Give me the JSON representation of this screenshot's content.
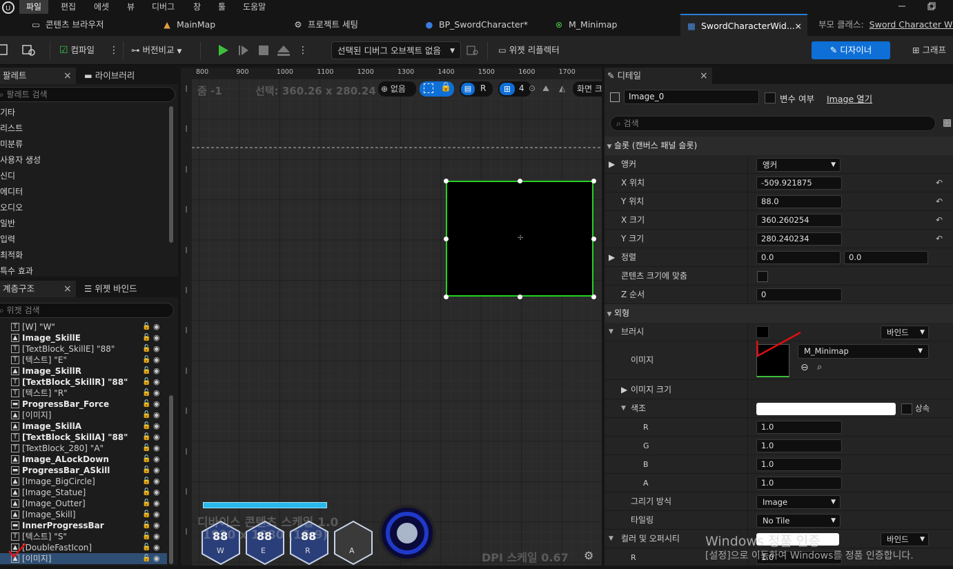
{
  "menu": {
    "items": [
      "파일",
      "편집",
      "에셋",
      "뷰",
      "디버그",
      "창",
      "툴",
      "도움말"
    ]
  },
  "tabs": [
    {
      "label": "콘텐츠 브라우저",
      "icon": "folder-icon"
    },
    {
      "label": "MainMap",
      "icon": "level-icon"
    },
    {
      "label": "프로젝트 세팅",
      "icon": "gear-icon"
    },
    {
      "label": "BP_SwordCharacter*",
      "icon": "blueprint-icon"
    },
    {
      "label": "M_Minimap",
      "icon": "material-icon"
    },
    {
      "label": "SwordCharacterWid...",
      "icon": "widget-icon"
    }
  ],
  "tab_close": "×",
  "parent_class": {
    "label": "부모 클래스:",
    "value": "Sword Character Widget"
  },
  "toolbar": {
    "compile": "컴파일",
    "diff": "버전비교",
    "debug_object": "선택된 디버그 오브젝트 없음",
    "widget_reflector": "위젯 리플렉터",
    "designer": "디자이너",
    "graph": "그래프"
  },
  "palette": {
    "tab": "팔레트",
    "tab2": "라이브러리",
    "close": "×",
    "search_placeholder": "팔레트 검색",
    "items": [
      "기타",
      "리스트",
      "미분류",
      "사용자 생성",
      "신디",
      "에디터",
      "오디오",
      "일반",
      "입력",
      "최적화",
      "특수 효과"
    ]
  },
  "hierarchy": {
    "tab": "계층구조",
    "tab2": "위젯 바인드",
    "close": "×",
    "search_placeholder": "위젯 검색",
    "rows": [
      {
        "label": "[W] \"W\"",
        "icon": "T",
        "bold": false
      },
      {
        "label": "Image_SkillE",
        "icon": "img",
        "bold": true
      },
      {
        "label": "[TextBlock_SkillE] \"88\"",
        "icon": "T",
        "bold": false
      },
      {
        "label": "[텍스트] \"E\"",
        "icon": "T",
        "bold": false
      },
      {
        "label": "Image_SkillR",
        "icon": "img",
        "bold": true
      },
      {
        "label": "[TextBlock_SkillR] \"88\"",
        "icon": "T",
        "bold": true
      },
      {
        "label": "[텍스트] \"R\"",
        "icon": "T",
        "bold": false
      },
      {
        "label": "ProgressBar_Force",
        "icon": "bar",
        "bold": true
      },
      {
        "label": "[이미지]",
        "icon": "img",
        "bold": false
      },
      {
        "label": "Image_SkillA",
        "icon": "img",
        "bold": true
      },
      {
        "label": "[TextBlock_SkillA] \"88\"",
        "icon": "T",
        "bold": true
      },
      {
        "label": "[TextBlock_280] \"A\"",
        "icon": "T",
        "bold": false
      },
      {
        "label": "Image_ALockDown",
        "icon": "img",
        "bold": true
      },
      {
        "label": "ProgressBar_ASkill",
        "icon": "bar",
        "bold": true
      },
      {
        "label": "[Image_BigCircle]",
        "icon": "img",
        "bold": false
      },
      {
        "label": "[Image_Statue]",
        "icon": "img",
        "bold": false
      },
      {
        "label": "[Image_Outter]",
        "icon": "img",
        "bold": false
      },
      {
        "label": "[Image_Skill]",
        "icon": "img",
        "bold": false
      },
      {
        "label": "InnerProgressBar",
        "icon": "bar",
        "bold": true
      },
      {
        "label": "[텍스트] \"S\"",
        "icon": "T",
        "bold": false
      },
      {
        "label": "[DoubleFastIcon]",
        "icon": "img",
        "bold": false
      },
      {
        "label": "[이미지]",
        "icon": "img",
        "bold": false,
        "selected": true
      }
    ]
  },
  "designer": {
    "zoom": "줌 -1",
    "selection": "선택: 360.26 x 280.24",
    "none_label": "없음",
    "r_label": "R",
    "grid_value": "4",
    "screen_label": "화면 크",
    "ruler_h": [
      "800",
      "900",
      "1000",
      "1100",
      "1200",
      "1300",
      "1400",
      "1500",
      "1600",
      "1700"
    ],
    "dpi_scale": "DPI 스케일 0.67",
    "device_label": "디바이스 콘텐츠 스케일 1.0",
    "resolution_label": "1920 x 1080 (16:9)",
    "skills": [
      {
        "text": "88",
        "key": "W"
      },
      {
        "text": "88",
        "key": "E"
      },
      {
        "text": "88",
        "key": "R"
      },
      {
        "text": "",
        "key": "A"
      }
    ]
  },
  "details": {
    "tab": "디테일",
    "close": "×",
    "name": "Image_0",
    "is_variable": "변수 여부",
    "open_image": "Image 열기",
    "search_placeholder": "검색",
    "slot_section": "슬롯 (캔버스 패널 슬롯)",
    "anchor_label": "앵커",
    "anchor_value": "앵커",
    "pos_x_label": "X 위치",
    "pos_x": "-509.921875",
    "pos_y_label": "Y 위치",
    "pos_y": "88.0",
    "size_x_label": "X 크기",
    "size_x": "360.260254",
    "size_y_label": "Y 크기",
    "size_y": "280.240234",
    "align_label": "정렬",
    "align_x": "0.0",
    "align_y": "0.0",
    "size_to_content": "콘텐츠 크기에 맞춤",
    "z_order_label": "Z 순서",
    "z_order": "0",
    "appearance_section": "외형",
    "brush_label": "브러시",
    "bind_label": "바인드",
    "image_label": "이미지",
    "image_value": "M_Minimap",
    "image_size_label": "이미지 크기",
    "tint_label": "색조",
    "inherit_label": "상속",
    "r_label": "R",
    "r": "1.0",
    "g_label": "G",
    "g": "1.0",
    "b_label": "B",
    "b": "1.0",
    "a_label": "A",
    "a": "1.0",
    "draw_as_label": "그리기 방식",
    "draw_as": "Image",
    "tiling_label": "타일링",
    "tiling": "No Tile",
    "color_opacity_label": "컬러 및 오퍼시티",
    "bind2_label": "바인드",
    "r2_label": "R",
    "r2": "1.0"
  },
  "watermark": {
    "line1": "Windows 정품 인증",
    "line2": "[설정]으로 이동하여 Windows를 정품 인증합니다."
  },
  "colors": {
    "accent": "#0e6fd6",
    "selection_outline": "#22d322",
    "tint_swatch": "#ffffff",
    "annotation": "#e01010"
  }
}
